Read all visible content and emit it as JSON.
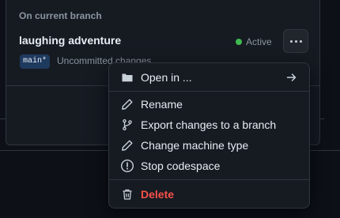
{
  "section": {
    "heading": "On current branch"
  },
  "codespace": {
    "name": "laughing adventure",
    "status": "Active",
    "status_color": "#3fb950",
    "branch": "main*",
    "changes_text": "Uncommitted changes",
    "more_icon": "kebab-horizontal-icon"
  },
  "menu": {
    "items": [
      {
        "label": "Open in ...",
        "icon": "folder-icon",
        "trailing_icon": "arrow-right-icon"
      },
      {
        "label": "Rename",
        "icon": "pencil-icon"
      },
      {
        "label": "Export changes to a branch",
        "icon": "git-branch-icon"
      },
      {
        "label": "Change machine type",
        "icon": "pencil-icon"
      },
      {
        "label": "Stop codespace",
        "icon": "stop-icon"
      },
      {
        "label": "Delete",
        "icon": "trash-icon",
        "color": "#f85149"
      }
    ]
  },
  "colors": {
    "background": "#0d1117",
    "surface": "#161b22",
    "border": "#30363d",
    "text": "#e6edf3",
    "muted": "#8b949e",
    "danger": "#f85149"
  }
}
